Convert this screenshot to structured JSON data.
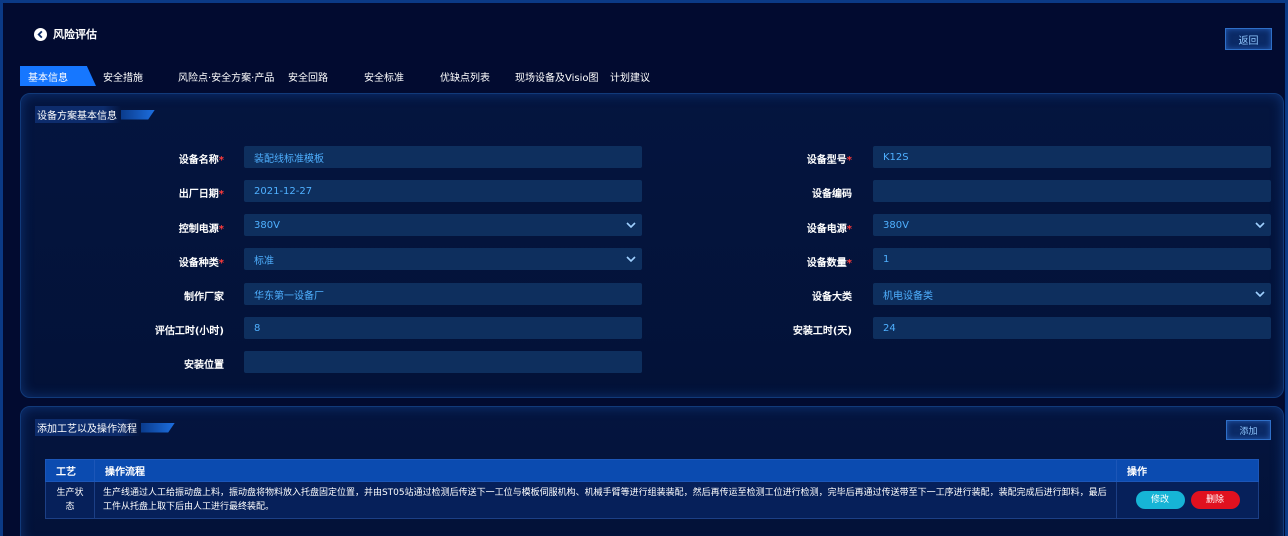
{
  "header": {
    "title": "风险评估",
    "return_label": "返回"
  },
  "tabs": [
    {
      "label": "基本信息",
      "active": true
    },
    {
      "label": "安全措施",
      "active": false
    },
    {
      "label": "风险点·安全方案·产品",
      "active": false
    },
    {
      "label": "安全回路",
      "active": false
    },
    {
      "label": "安全标准",
      "active": false
    },
    {
      "label": "优缺点列表",
      "active": false
    },
    {
      "label": "现场设备及Visio图",
      "active": false
    },
    {
      "label": "计划建议",
      "active": false
    }
  ],
  "basic": {
    "title": "设备方案基本信息",
    "required_mark": "*",
    "fields": {
      "device_name": {
        "label": "设备名称",
        "value": "装配线标准模板"
      },
      "device_model": {
        "label": "设备型号",
        "value": "K12S"
      },
      "factory_date": {
        "label": "出厂日期",
        "value": "2021-12-27"
      },
      "device_code": {
        "label": "设备编码",
        "value": ""
      },
      "control_power": {
        "label": "控制电源",
        "value": "380V"
      },
      "device_power": {
        "label": "设备电源",
        "value": "380V"
      },
      "device_type": {
        "label": "设备种类",
        "value": "标准"
      },
      "device_count": {
        "label": "设备数量",
        "value": "1"
      },
      "manufacturer": {
        "label": "制作厂家",
        "value": "华东第一设备厂"
      },
      "device_category": {
        "label": "设备大类",
        "value": "机电设备类"
      },
      "eval_hours": {
        "label": "评估工时(小时)",
        "value": "8"
      },
      "install_days": {
        "label": "安装工时(天)",
        "value": "24"
      },
      "install_location": {
        "label": "安装位置",
        "value": ""
      }
    }
  },
  "process": {
    "title": "添加工艺以及操作流程",
    "add_label": "添加",
    "columns": [
      "工艺",
      "操作流程",
      "操作"
    ],
    "rows": [
      {
        "craft": "生产状态",
        "flow": "生产线通过人工给振动盘上料，振动盘将物料放入托盘固定位置，并由ST05站通过检测后传送下一工位与模板伺服机构、机械手臂等进行组装装配，然后再传运至检测工位进行检测，完毕后再通过传送带至下一工序进行装配，装配完成后进行卸料，最后工件从托盘上取下后由人工进行最终装配。",
        "edit_label": "修改",
        "delete_label": "删除"
      }
    ]
  }
}
